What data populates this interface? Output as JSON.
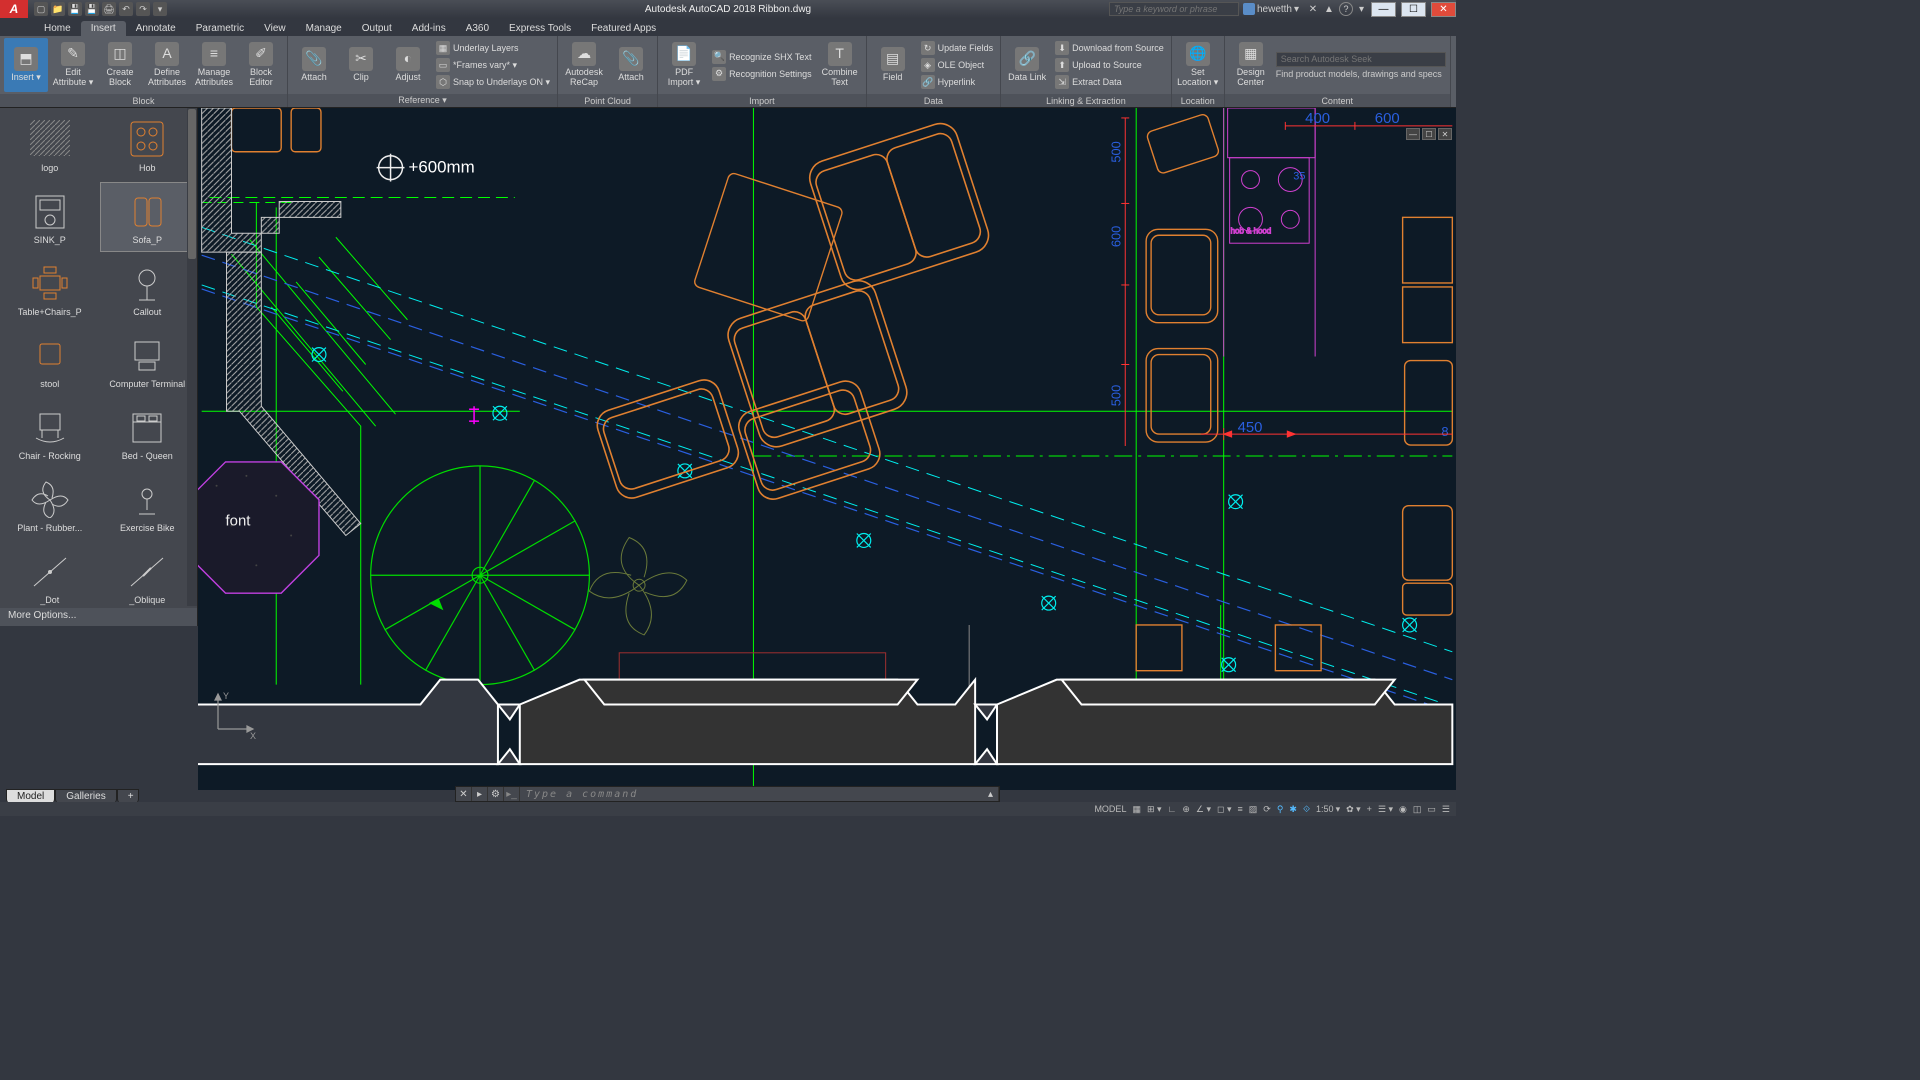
{
  "app": {
    "title": "Autodesk AutoCAD 2018    Ribbon.dwg",
    "logo_letter": "A"
  },
  "search": {
    "placeholder": "Type a keyword or phrase"
  },
  "user": {
    "name": "hewetth"
  },
  "tabs": [
    "Home",
    "Insert",
    "Annotate",
    "Parametric",
    "View",
    "Manage",
    "Output",
    "Add-ins",
    "A360",
    "Express Tools",
    "Featured Apps"
  ],
  "active_tab": 1,
  "ribbon": {
    "panels": [
      {
        "title": "Block",
        "items": [
          {
            "t": "big",
            "accent": true,
            "label": "Insert",
            "dd": true,
            "ico": "⬒"
          },
          {
            "t": "big",
            "label": "Edit Attribute",
            "dd": true,
            "ico": "✎"
          },
          {
            "t": "big",
            "label": "Create Block",
            "ico": "◫"
          },
          {
            "t": "big",
            "label": "Define Attributes",
            "ico": "A"
          },
          {
            "t": "big",
            "label": "Manage Attributes",
            "ico": "≡"
          },
          {
            "t": "big",
            "label": "Block Editor",
            "ico": "✐"
          }
        ]
      },
      {
        "title": "Reference ▾",
        "items": [
          {
            "t": "big",
            "label": "Attach",
            "ico": "📎"
          },
          {
            "t": "big",
            "label": "Clip",
            "ico": "✂"
          },
          {
            "t": "big",
            "label": "Adjust",
            "ico": "◐"
          },
          {
            "t": "list",
            "rows": [
              {
                "ico": "▦",
                "text": "Underlay Layers"
              },
              {
                "ico": "▭",
                "text": "*Frames vary* ▾"
              },
              {
                "ico": "⬡",
                "text": "Snap to Underlays ON ▾"
              }
            ]
          }
        ]
      },
      {
        "title": "Point Cloud",
        "items": [
          {
            "t": "big",
            "label": "Autodesk ReCap",
            "ico": "☁"
          },
          {
            "t": "big",
            "label": "Attach",
            "ico": "📎"
          }
        ]
      },
      {
        "title": "Import",
        "items": [
          {
            "t": "big",
            "label": "PDF Import",
            "dd": true,
            "ico": "📄"
          },
          {
            "t": "list",
            "rows": [
              {
                "ico": "🔍",
                "text": "Recognize SHX Text"
              },
              {
                "ico": "⚙",
                "text": "Recognition Settings"
              }
            ]
          },
          {
            "t": "big",
            "label": "Combine Text",
            "ico": "T"
          }
        ]
      },
      {
        "title": "Data",
        "items": [
          {
            "t": "big",
            "label": "Field",
            "ico": "▤"
          },
          {
            "t": "list",
            "rows": [
              {
                "ico": "↻",
                "text": "Update Fields"
              },
              {
                "ico": "◈",
                "text": "OLE Object"
              },
              {
                "ico": "🔗",
                "text": "Hyperlink"
              }
            ]
          }
        ]
      },
      {
        "title": "Linking & Extraction",
        "items": [
          {
            "t": "big",
            "label": "Data Link",
            "ico": "🔗"
          },
          {
            "t": "list",
            "rows": [
              {
                "ico": "⬇",
                "text": "Download from Source"
              },
              {
                "ico": "⬆",
                "text": "Upload to Source"
              },
              {
                "ico": "⇲",
                "text": "Extract  Data"
              }
            ]
          }
        ]
      },
      {
        "title": "Location",
        "items": [
          {
            "t": "big",
            "label": "Set Location",
            "dd": true,
            "ico": "🌐"
          }
        ]
      },
      {
        "title": "Content",
        "items": [
          {
            "t": "big",
            "label": "Design Center",
            "ico": "▦"
          },
          {
            "t": "seek",
            "ph": "Search Autodesk Seek",
            "hint": "Find product models, drawings and specs"
          }
        ]
      }
    ]
  },
  "palette": {
    "items": [
      {
        "label": "logo",
        "svg": "hatch"
      },
      {
        "label": "Hob",
        "svg": "hob"
      },
      {
        "label": "SINK_P",
        "svg": "sink"
      },
      {
        "label": "Sofa_P",
        "svg": "sofa",
        "selected": true
      },
      {
        "label": "Table+Chairs_P",
        "svg": "table"
      },
      {
        "label": "Callout",
        "svg": "callout"
      },
      {
        "label": "stool",
        "svg": "stool"
      },
      {
        "label": "Computer Terminal",
        "svg": "comp"
      },
      {
        "label": "Chair - Rocking",
        "svg": "rock"
      },
      {
        "label": "Bed - Queen",
        "svg": "bed"
      },
      {
        "label": "Plant - Rubber...",
        "svg": "plant"
      },
      {
        "label": "Exercise Bike",
        "svg": "bike"
      },
      {
        "label": "_Dot",
        "svg": "dot"
      },
      {
        "label": "_Oblique",
        "svg": "oblique"
      }
    ],
    "more": "More Options..."
  },
  "canvas": {
    "elev_text": "+600mm",
    "font_text": "font",
    "dims": {
      "d450": "450",
      "d400": "400",
      "d600": "600",
      "d500a": "500",
      "d500b": "500",
      "d600b": "600",
      "d8": "8",
      "d35": "35"
    },
    "hobhood": "hob & hood"
  },
  "bottom": {
    "tabs": [
      "Model",
      "Galleries"
    ],
    "active": 0
  },
  "cmd": {
    "placeholder": "Type a command"
  },
  "status": {
    "space": "MODEL",
    "scale": "1:50"
  }
}
